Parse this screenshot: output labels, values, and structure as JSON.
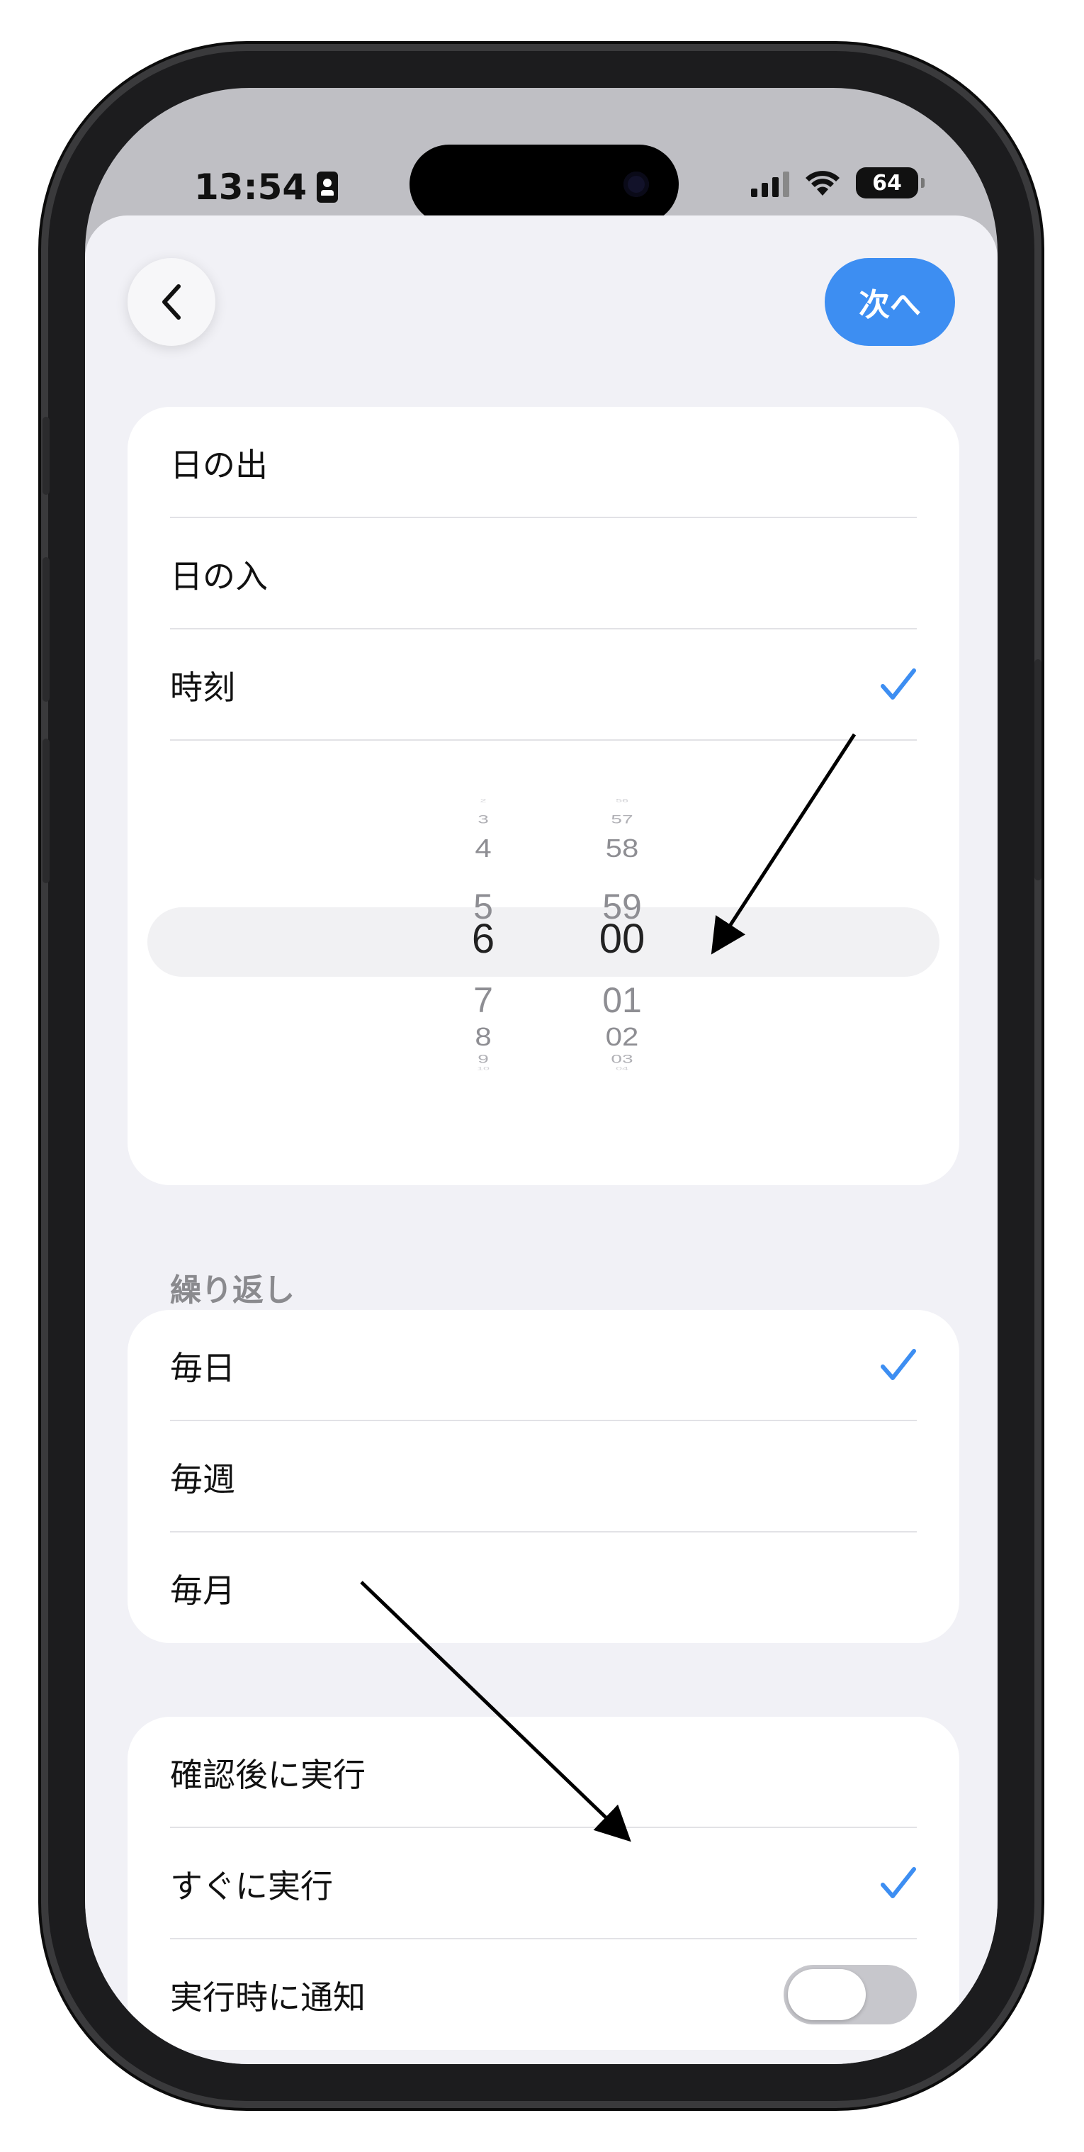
{
  "status_bar": {
    "time": "13:54",
    "battery": "64"
  },
  "nav": {
    "next_label": "次へ"
  },
  "trigger_options": [
    {
      "label": "日の出",
      "selected": false
    },
    {
      "label": "日の入",
      "selected": false
    },
    {
      "label": "時刻",
      "selected": true
    }
  ],
  "time_picker": {
    "hours": [
      "2",
      "3",
      "4",
      "5",
      "6",
      "7",
      "8",
      "9",
      "10"
    ],
    "minutes": [
      "56",
      "57",
      "58",
      "59",
      "00",
      "01",
      "02",
      "03",
      "04"
    ],
    "selected_hour": "6",
    "selected_minute": "00"
  },
  "repeat_section": {
    "header": "繰り返し",
    "options": [
      {
        "label": "毎日",
        "selected": true
      },
      {
        "label": "毎週",
        "selected": false
      },
      {
        "label": "毎月",
        "selected": false
      }
    ]
  },
  "run_section": {
    "options": [
      {
        "label": "確認後に実行",
        "selected": false
      },
      {
        "label": "すぐに実行",
        "selected": true
      }
    ],
    "notify": {
      "label": "実行時に通知",
      "enabled": false
    }
  },
  "colors": {
    "accent": "#3d8ef2",
    "background": "#f1f1f6",
    "card": "#ffffff",
    "toggle_off": "#c7c7cc"
  },
  "icons": [
    "back-chevron-icon",
    "checkmark-icon",
    "wifi-icon",
    "cellular-signal-icon",
    "battery-icon",
    "id-card-icon"
  ]
}
